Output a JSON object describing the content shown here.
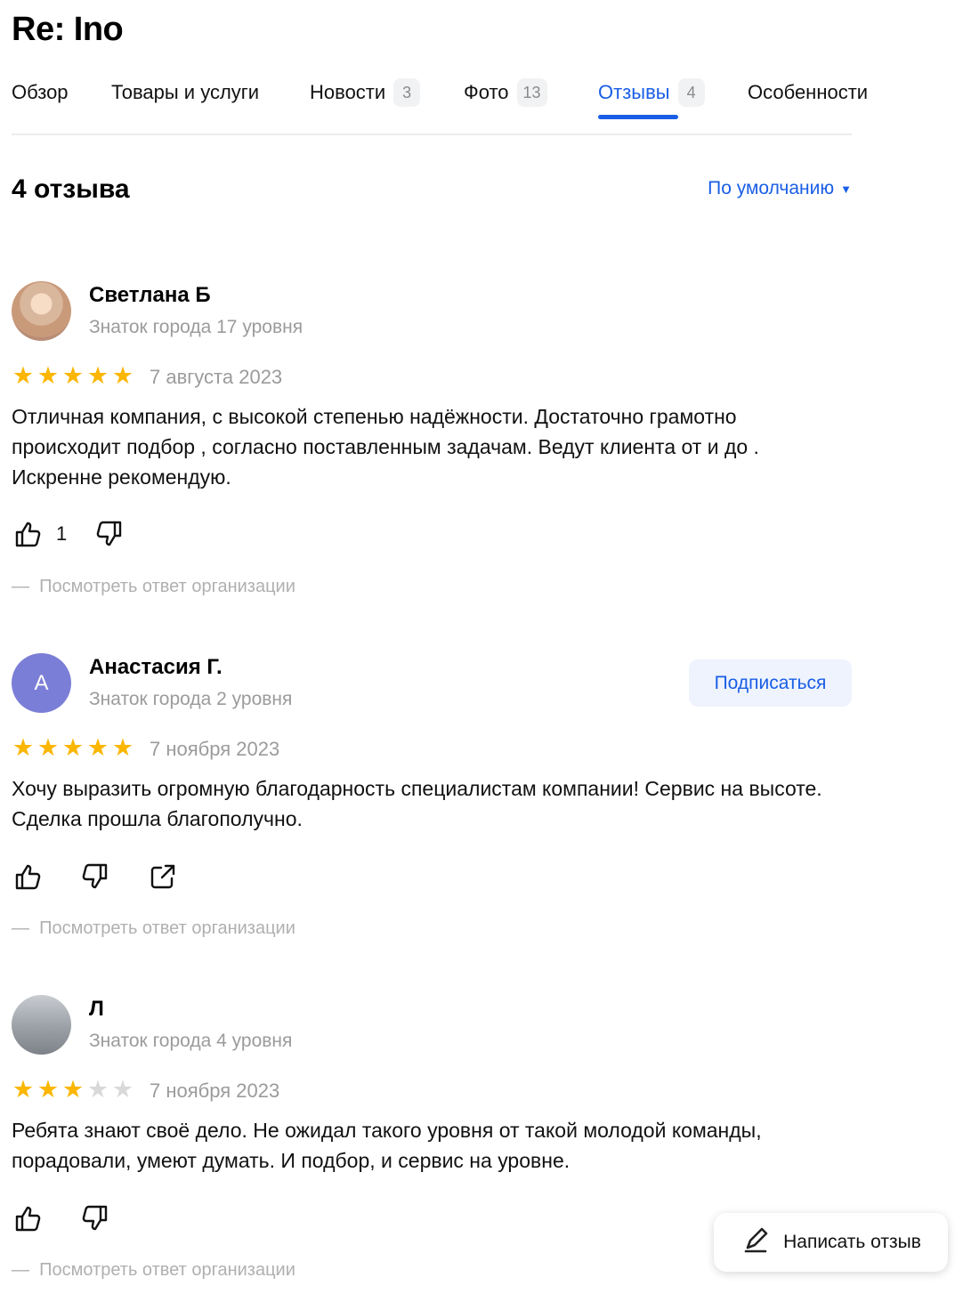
{
  "header": {
    "title": "Re: Ino"
  },
  "tabs": [
    {
      "label": "Обзор",
      "count": null
    },
    {
      "label": "Товары и услуги",
      "count": null
    },
    {
      "label": "Новости",
      "count": "3"
    },
    {
      "label": "Фото",
      "count": "13"
    },
    {
      "label": "Отзывы",
      "count": "4"
    },
    {
      "label": "Особенности",
      "count": null
    }
  ],
  "active_tab": "Отзывы",
  "accent_color": "#1a5ee6",
  "star_color": "#fbb600",
  "reviews_header": {
    "count_label": "4 отзыва",
    "sort_label": "По умолчанию"
  },
  "reviews": [
    {
      "author": "Светлана Б",
      "level": "Знаток города 17 уровня",
      "avatar": {
        "type": "photo"
      },
      "rating": 5,
      "date": "7 августа 2023",
      "text": "Отличная компания, с высокой степенью надёжности. Достаточно грамотно происходит подбор , согласно поставленным задачам. Ведут клиента от и до . Искренне рекомендую.",
      "likes": "1",
      "org_reply_link": "Посмотреть ответ организации"
    },
    {
      "author": "Анастасия Г.",
      "level": "Знаток города 2 уровня",
      "avatar": {
        "type": "letter",
        "letter": "А",
        "color": "#7b7ed6"
      },
      "subscribe_label": "Подписаться",
      "rating": 5,
      "date": "7 ноября 2023",
      "text": "Хочу выразить огромную благодарность специалистам компании! Сервис на высоте. Сделка прошла благополучно.",
      "org_reply_link": "Посмотреть ответ организации"
    },
    {
      "author": "Л",
      "level": "Знаток города 4 уровня",
      "avatar": {
        "type": "photo"
      },
      "rating": 3,
      "date": "7 ноября 2023",
      "text": "Ребята знают своё дело. Не ожидал такого уровня от такой молодой команды, порадовали, умеют думать. И подбор, и сервис на уровне.",
      "org_reply_link": "Посмотреть ответ организации"
    }
  ],
  "write_review_label": "Написать отзыв"
}
